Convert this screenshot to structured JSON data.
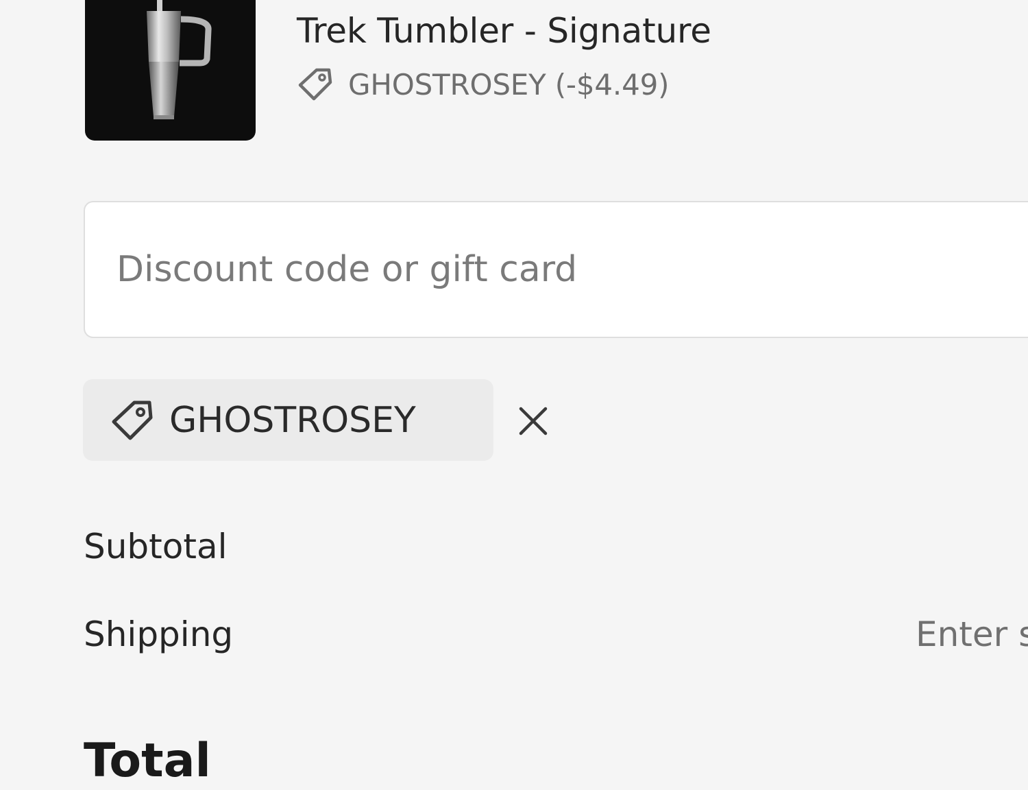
{
  "product": {
    "title": "Trek Tumbler - Signature",
    "discount_line": "GHOSTROSEY (-$4.49)",
    "image_alt": "tumbler-image"
  },
  "discount": {
    "placeholder": "Discount code or gift card",
    "applied_code": "GHOSTROSEY"
  },
  "summary": {
    "subtotal_label": "Subtotal",
    "shipping_label": "Shipping",
    "shipping_value": "Enter s",
    "total_label": "Total"
  },
  "colors": {
    "background": "#f5f5f5",
    "chip_background": "#ebebeb",
    "input_background": "#ffffff",
    "thumb_background": "#0d0d0d"
  },
  "icons": {
    "discount_tag": "tag-icon",
    "remove_code": "close-icon"
  }
}
